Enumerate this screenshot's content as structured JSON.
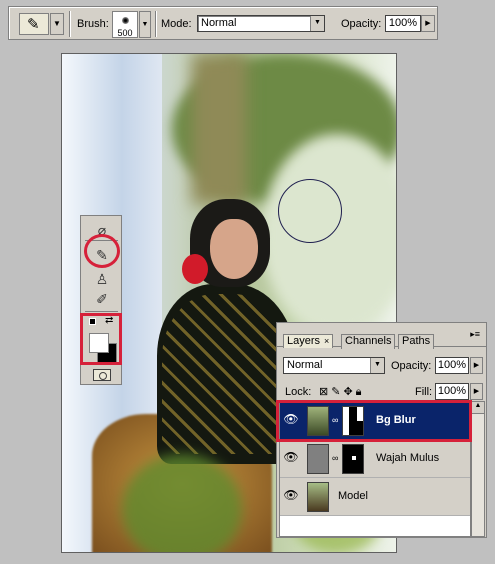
{
  "options_bar": {
    "brush_label": "Brush:",
    "brush_size": "500",
    "mode_label": "Mode:",
    "mode_value": "Normal",
    "opacity_label": "Opacity:",
    "opacity_value": "100%"
  },
  "layers_panel": {
    "tabs": [
      {
        "label": "Layers",
        "close": "×"
      },
      {
        "label": "Channels"
      },
      {
        "label": "Paths"
      }
    ],
    "blend_mode": "Normal",
    "opacity_label": "Opacity:",
    "opacity_value": "100%",
    "lock_label": "Lock:",
    "fill_label": "Fill:",
    "fill_value": "100%",
    "layers": [
      {
        "name": "Bg Blur",
        "selected": true
      },
      {
        "name": "Wajah Mulus",
        "selected": false
      },
      {
        "name": "Model",
        "selected": false
      }
    ]
  },
  "colors": {
    "highlight": "#d6213a",
    "selected_layer": "#0a246a"
  },
  "icons": [
    "brush-tool-icon",
    "eye-icon",
    "chain-icon",
    "lock-icon",
    "move-icon",
    "swap-colors-icon",
    "quick-mask-icon"
  ]
}
